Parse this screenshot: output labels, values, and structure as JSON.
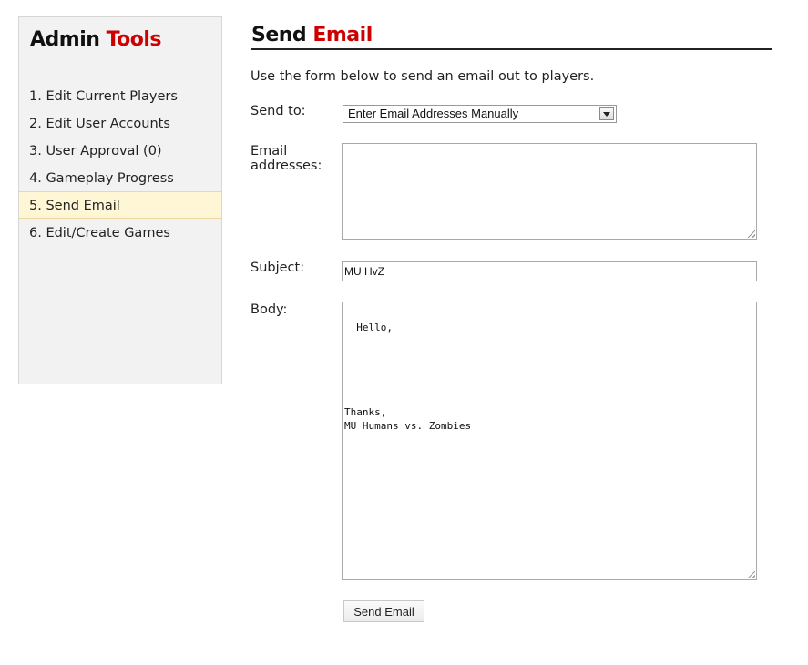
{
  "sidebar": {
    "title_main": "Admin",
    "title_accent": "Tools",
    "items": [
      {
        "label": "1. Edit Current Players"
      },
      {
        "label": "2. Edit User Accounts"
      },
      {
        "label": "3. User Approval (0)"
      },
      {
        "label": "4. Gameplay Progress"
      },
      {
        "label": "5. Send Email",
        "active": true
      },
      {
        "label": "6. Edit/Create Games"
      }
    ]
  },
  "main": {
    "title_main": "Send",
    "title_accent": "Email",
    "intro": "Use the form below to send an email out to players.",
    "form": {
      "send_to_label": "Send to:",
      "send_to_value": "Enter Email Addresses Manually",
      "emails_label_line1": "Email",
      "emails_label_line2": "addresses:",
      "emails_value": "",
      "subject_label": "Subject:",
      "subject_value": "MU HvZ",
      "body_label": "Body:",
      "body_value": "Hello,\n\n\n\n\n\nThanks,\nMU Humans vs. Zombies",
      "submit_label": "Send Email"
    }
  },
  "colors": {
    "accent": "#cc0000",
    "sidebar_bg": "#f2f2f2",
    "active_item_bg": "#fff6d6"
  }
}
